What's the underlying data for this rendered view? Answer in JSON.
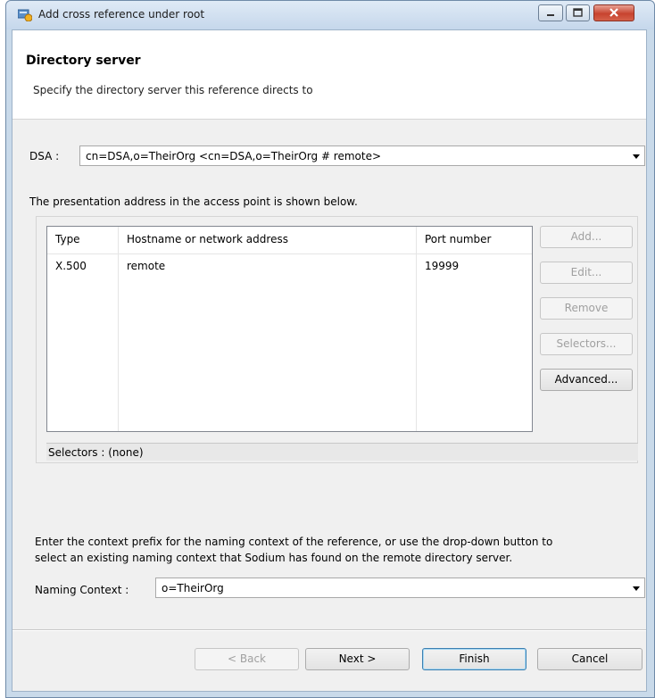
{
  "window": {
    "title": "Add cross reference under root"
  },
  "banner": {
    "title": "Directory server",
    "subtitle": "Specify the directory server this reference directs to"
  },
  "dsa": {
    "label": "DSA :",
    "value": "cn=DSA,o=TheirOrg <cn=DSA,o=TheirOrg # remote>"
  },
  "presentation": {
    "description": "The presentation address in the access point is shown below."
  },
  "table": {
    "columns": [
      "Type",
      "Hostname or network address",
      "Port number"
    ],
    "rows": [
      {
        "type": "X.500",
        "host": "remote",
        "port": "19999"
      }
    ]
  },
  "side_buttons": {
    "add": "Add...",
    "edit": "Edit...",
    "remove": "Remove",
    "selectors": "Selectors...",
    "advanced": "Advanced..."
  },
  "selectors_status": "Selectors : (none)",
  "naming": {
    "help_line1": "Enter the context prefix for the naming context of the reference, or use the drop-down button to",
    "help_line2": "select an existing naming context that Sodium has found on the remote directory server.",
    "label": "Naming Context :",
    "value": "o=TheirOrg"
  },
  "footer": {
    "back": "< Back",
    "next": "Next >",
    "finish": "Finish",
    "cancel": "Cancel"
  }
}
